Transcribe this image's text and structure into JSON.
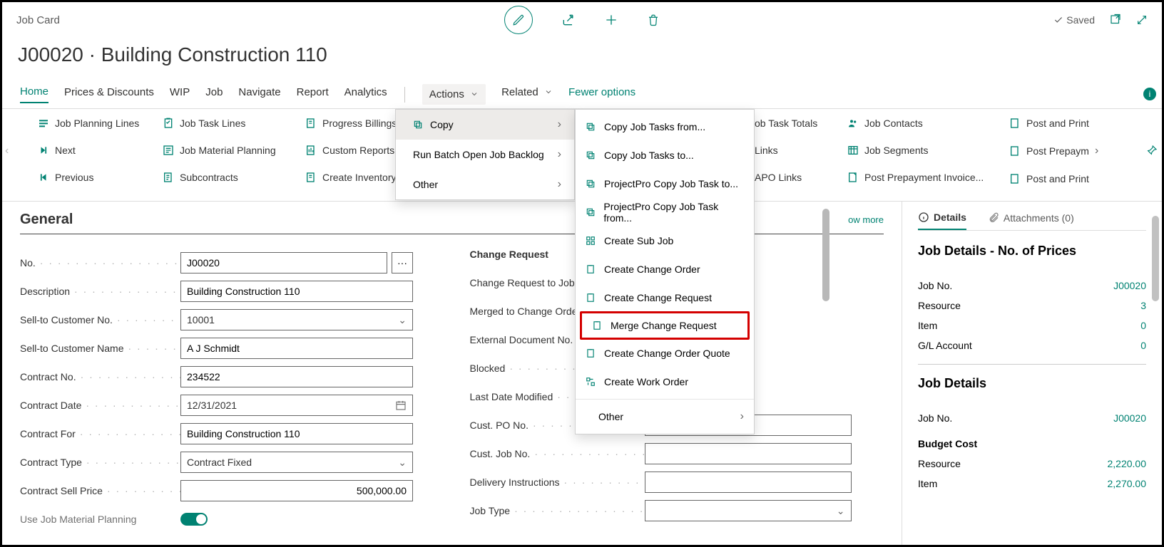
{
  "page": {
    "name": "Job Card",
    "title": "J00020 · Building Construction 110",
    "saved": "Saved"
  },
  "nav": {
    "home": "Home",
    "prices": "Prices & Discounts",
    "wip": "WIP",
    "job": "Job",
    "navigate": "Navigate",
    "report": "Report",
    "analytics": "Analytics",
    "actions": "Actions",
    "related": "Related",
    "fewer": "Fewer options"
  },
  "ribbon": {
    "col1": {
      "planning": "Job Planning Lines",
      "next": "Next",
      "prev": "Previous"
    },
    "col2": {
      "tasklines": "Job Task Lines",
      "matplan": "Job Material Planning",
      "subc": "Subcontracts"
    },
    "col3": {
      "progress": "Progress Billings",
      "custom": "Custom Reports",
      "createinv": "Create Inventory"
    },
    "col6a": {
      "totals": "ob Task Totals",
      "links": "Links",
      "apolinks": "APO Links"
    },
    "col6b": {
      "contacts": "Job Contacts",
      "segments": "Job Segments",
      "prepay": "Post Prepayment Invoice..."
    },
    "col7": {
      "postprint1": "Post and Print",
      "postprepay": "Post Prepaym",
      "postprint2": "Post and Print"
    }
  },
  "menu1": {
    "copy": "Copy",
    "runbatch": "Run Batch Open Job Backlog",
    "other": "Other"
  },
  "menu2": {
    "copyfrom": "Copy Job Tasks from...",
    "copyto": "Copy Job Tasks to...",
    "ppcopyto": "ProjectPro Copy Job Task to...",
    "ppcopyfrom": "ProjectPro Copy Job Task from...",
    "subjob": "Create Sub Job",
    "changeorder": "Create Change Order",
    "changereq": "Create Change Request",
    "mergecr": "Merge Change Request",
    "coquote": "Create Change Order Quote",
    "workorder": "Create Work Order",
    "other": "Other"
  },
  "general": {
    "label": "General",
    "showmore": "ow more",
    "no_lbl": "No.",
    "no": "J00020",
    "desc_lbl": "Description",
    "desc": "Building Construction 110",
    "sellno_lbl": "Sell-to Customer No.",
    "sellno": "10001",
    "sellname_lbl": "Sell-to Customer Name",
    "sellname": "A J Schmidt",
    "contractno_lbl": "Contract No.",
    "contractno": "234522",
    "contractdate_lbl": "Contract Date",
    "contractdate": "12/31/2021",
    "contractfor_lbl": "Contract For",
    "contractfor": "Building Construction 110",
    "contracttype_lbl": "Contract Type",
    "contracttype": "Contract Fixed",
    "sellprice_lbl": "Contract Sell Price",
    "sellprice": "500,000.00",
    "usemat_lbl": "Use Job Material Planning",
    "col2": {
      "cr_hdr": "Change Request",
      "crtojob_lbl": "Change Request to Job No.",
      "mergedco_lbl": "Merged to Change Order No.",
      "extdoc_lbl": "External Document No.",
      "blocked_lbl": "Blocked",
      "lastmod_lbl": "Last Date Modified",
      "custpo_lbl": "Cust. PO No.",
      "custjob_lbl": "Cust. Job No.",
      "delivery_lbl": "Delivery Instructions",
      "jobtype_lbl": "Job Type"
    }
  },
  "side": {
    "details_tab": "Details",
    "attach_tab": "Attachments (0)",
    "h1": "Job Details - No. of Prices",
    "jobno_lbl": "Job No.",
    "jobno": "J00020",
    "resource_lbl": "Resource",
    "resource": "3",
    "item_lbl": "Item",
    "item": "0",
    "gl_lbl": "G/L Account",
    "gl": "0",
    "h2": "Job Details",
    "jobno2_lbl": "Job No.",
    "jobno2": "J00020",
    "budget_hdr": "Budget Cost",
    "bres_lbl": "Resource",
    "bres": "2,220.00",
    "bitem_lbl": "Item",
    "bitem": "2,270.00"
  }
}
